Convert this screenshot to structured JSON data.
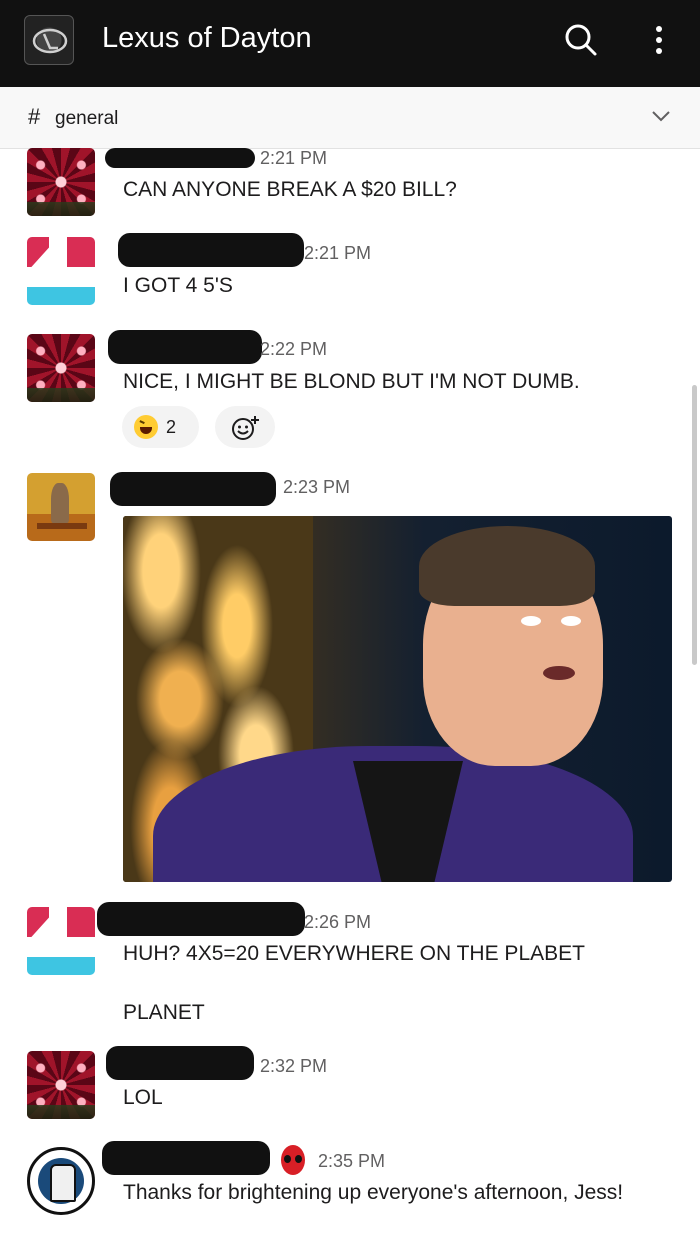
{
  "app_bar": {
    "workspace_title": "Lexus of Dayton",
    "search_icon": "search-icon",
    "more_icon": "more-vertical-icon"
  },
  "channel_bar": {
    "hash": "#",
    "channel_name": "general",
    "chevron_icon": "chevron-down-icon"
  },
  "messages": [
    {
      "time": "2:21 PM",
      "text": "CAN ANYONE BREAK A $20 BILL?",
      "avatar": "kaleidoscope-avatar"
    },
    {
      "time": "2:21 PM",
      "text": "I GOT 4 5'S",
      "avatar": "red-blue-logo-avatar"
    },
    {
      "time": "2:22 PM",
      "text": "NICE, I MIGHT BE BLOND BUT I'M NOT DUMB.",
      "avatar": "kaleidoscope-avatar",
      "reactions": [
        {
          "emoji": "laughing-emoji",
          "count": "2"
        }
      ],
      "add_reaction_icon": "add-reaction-icon"
    },
    {
      "time": "2:23 PM",
      "image": "comedian-photo",
      "avatar": "painting-avatar"
    },
    {
      "time": "2:26 PM",
      "text": "HUH? 4X5=20 EVERYWHERE ON THE PLABET",
      "avatar": "red-blue-logo-avatar"
    },
    {
      "text": "PLANET"
    },
    {
      "time": "2:32 PM",
      "text": "LOL",
      "avatar": "kaleidoscope-avatar"
    },
    {
      "time": "2:35 PM",
      "text": "Thanks for brightening up everyone's afternoon, Jess!",
      "avatar": "round-badge-avatar",
      "status_icon": "deadpool-icon"
    }
  ],
  "colors": {
    "app_bar_bg": "#111111",
    "channel_bar_bg": "#f8f8f8",
    "timestamp": "#616061",
    "text": "#1d1c1d"
  }
}
